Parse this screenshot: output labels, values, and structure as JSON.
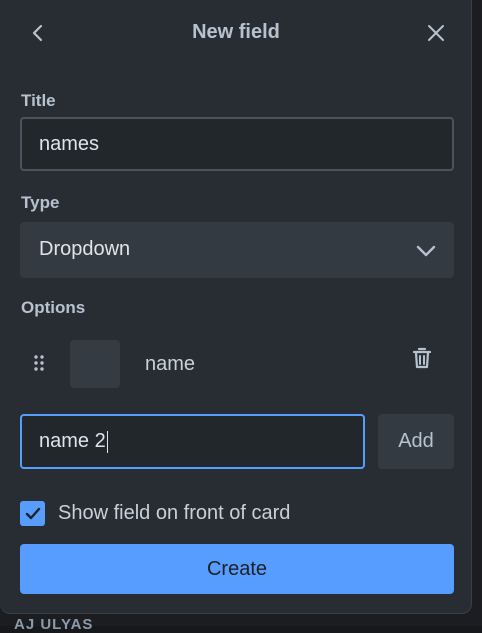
{
  "header": {
    "title": "New field"
  },
  "form": {
    "title_label": "Title",
    "title_value": "names",
    "type_label": "Type",
    "type_value": "Dropdown",
    "options_label": "Options",
    "options": [
      {
        "label": "name"
      }
    ],
    "new_option_value": "name 2",
    "add_label": "Add",
    "show_on_card_label": "Show field on front of card",
    "show_on_card_checked": true,
    "create_label": "Create"
  },
  "background": {
    "peek_text": "AJ ULYAS"
  },
  "colors": {
    "panel": "#282d33",
    "accent": "#579dff",
    "input_bg": "#22272b",
    "text": "#b6c2cf"
  },
  "icons": {
    "back": "chevron-left-icon",
    "close": "close-icon",
    "dropdown": "chevron-down-icon",
    "drag": "drag-handle-icon",
    "delete": "trash-icon",
    "check": "checkmark-icon"
  }
}
